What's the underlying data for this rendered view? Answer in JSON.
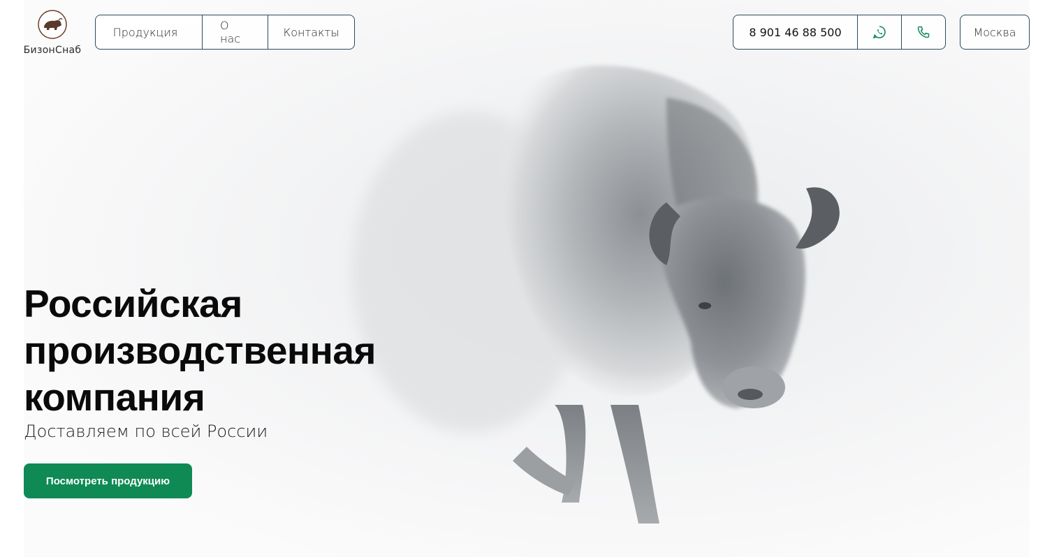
{
  "brand": {
    "name": "БизонСнаб",
    "logo_icon": "bison-logo-icon"
  },
  "nav": {
    "items": [
      {
        "label": "Продукция",
        "has_dropdown": true
      },
      {
        "label": "О нас"
      },
      {
        "label": "Контакты"
      }
    ]
  },
  "contacts": {
    "phone": "8 901 46 88 500",
    "whatsapp_icon": "whatsapp-icon",
    "phone_icon": "phone-icon"
  },
  "city": {
    "label": "Москва"
  },
  "hero": {
    "title_lines": [
      "Российская",
      "производственная",
      "компания"
    ],
    "subtitle": "Доставляем по всей России",
    "cta_label": "Посмотреть продукцию",
    "image": "bison-photo"
  },
  "colors": {
    "accent_green": "#0f8a55",
    "border": "#2f4a57",
    "icon_green": "#0f8a55"
  }
}
